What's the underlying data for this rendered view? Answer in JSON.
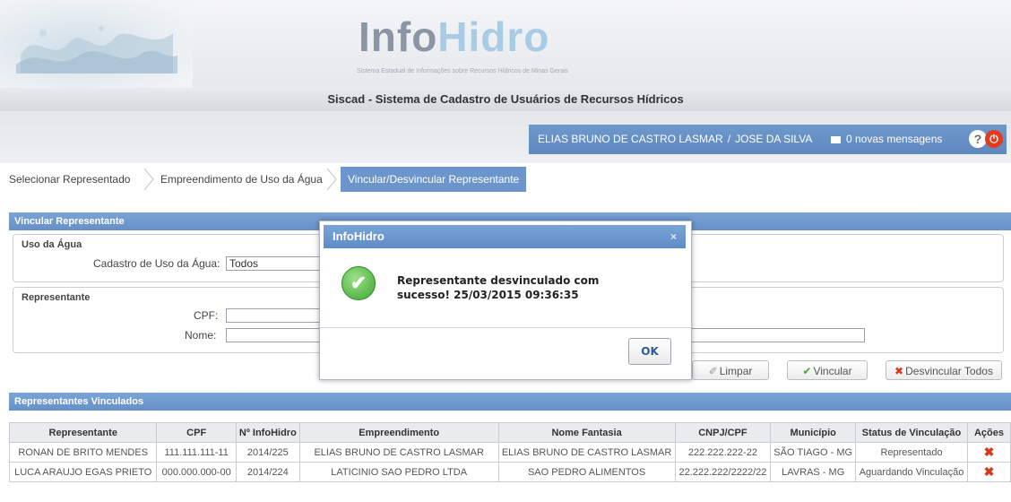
{
  "logo": {
    "part1": "Info",
    "part2": "Hidro",
    "subtitle": "Sistema Estadual de Informações sobre Recursos Hídricos de Minas Gerais"
  },
  "system_title": "Siscad - Sistema de Cadastro de Usuários de Recursos Hídricos",
  "user": {
    "name": "ELIAS BRUNO DE CASTRO LASMAR",
    "separator": "/",
    "represented": "JOSE DA SILVA",
    "messages": "0 novas mensagens",
    "help_icon": "?",
    "power_icon": "⏻"
  },
  "tabs": [
    {
      "label": "Selecionar Representado"
    },
    {
      "label": "Empreendimento de Uso da Água"
    },
    {
      "label": "Vincular/Desvincular Representante"
    }
  ],
  "vincular": {
    "title": "Vincular Representante",
    "uso_agua": {
      "legend": "Uso da Água",
      "label": "Cadastro de Uso da Água:",
      "value": "Todos"
    },
    "representante": {
      "legend": "Representante",
      "cpf_label": "CPF:",
      "cpf_value": "",
      "nome_label": "Nome:",
      "nome_value": ""
    },
    "buttons": {
      "limpar": "Limpar",
      "vincular": "Vincular",
      "desvincular": "Desvincular Todos"
    }
  },
  "vinculados": {
    "title": "Representantes Vinculados",
    "columns": [
      "Representante",
      "CPF",
      "Nº InfoHidro",
      "Empreendimento",
      "Nome Fantasia",
      "CNPJ/CPF",
      "Município",
      "Status de Vinculação",
      "Ações"
    ],
    "rows": [
      [
        "RONAN DE BRITO MENDES",
        "111.111.111-11",
        "2014/225",
        "ELIAS BRUNO DE CASTRO LASMAR",
        "ELIAS BRUNO DE CASTRO LASMAR",
        "222.222.222-22",
        "SÃO TIAGO - MG",
        "Representado",
        "✖"
      ],
      [
        "LUCA ARAUJO EGAS PRIETO",
        "000.000.000-00",
        "2014/224",
        "LATICINIO SAO PEDRO LTDA",
        "SAO PEDRO ALIMENTOS",
        "22.222.222/2222/22",
        "LAVRAS - MG",
        "Aguardando Vinculação",
        "✖"
      ]
    ]
  },
  "dialog": {
    "title": "InfoHidro",
    "close": "×",
    "message": "Representante desvinculado com sucesso! 25/03/2015 09:36:35",
    "ok": "OK"
  },
  "colors": {
    "accent": "#6c96cb",
    "delete": "#d33a1f",
    "success": "#3aa82c"
  }
}
